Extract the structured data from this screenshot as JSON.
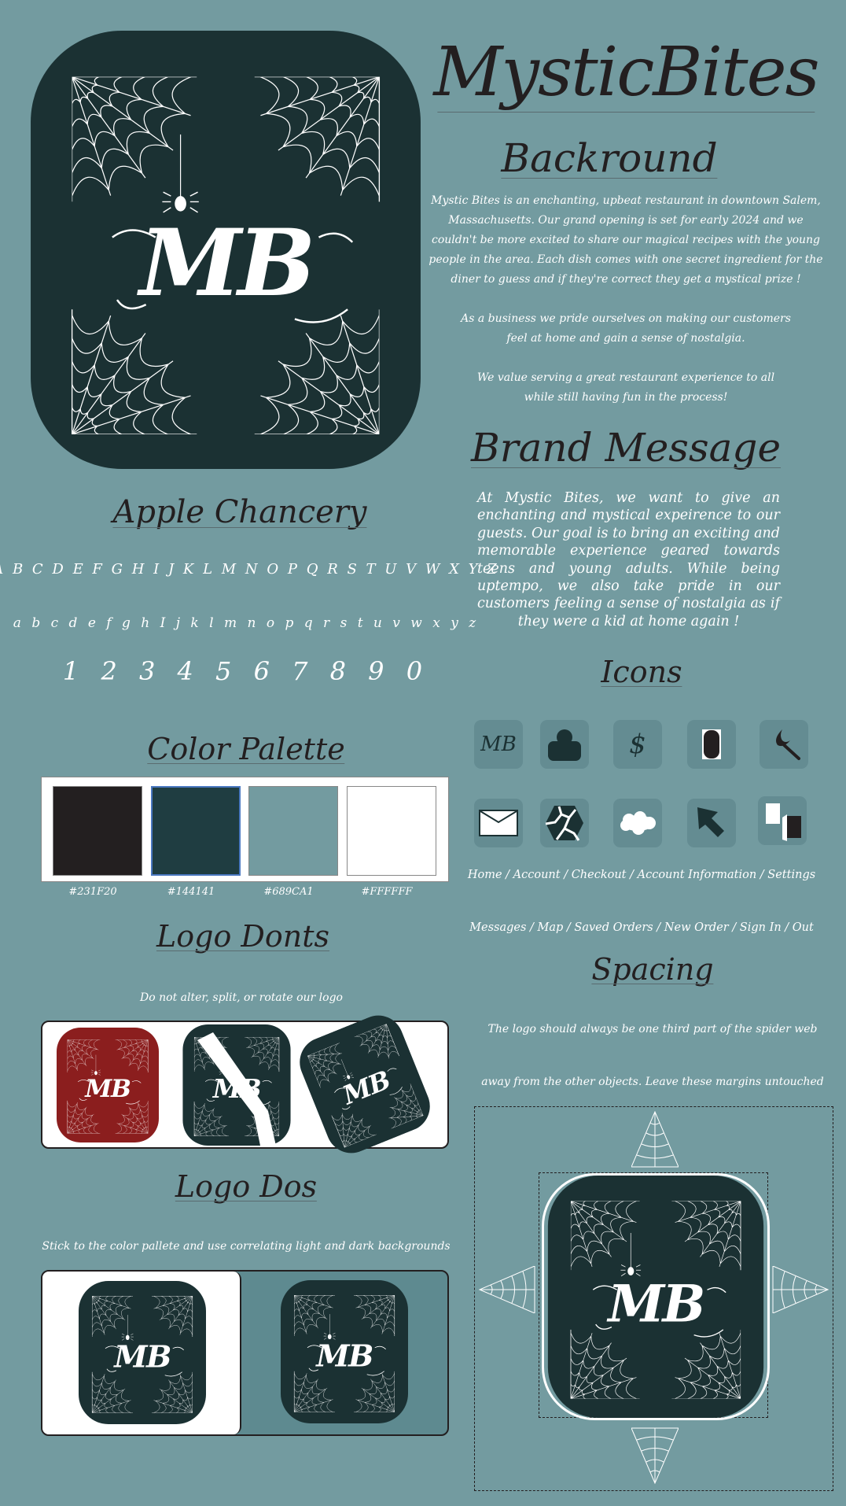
{
  "header": {
    "title": "MysticBites"
  },
  "background": {
    "heading": "Backround",
    "paragraphs": [
      "Mystic Bites is an enchanting, upbeat restaurant in downtown Salem, Massachusetts. Our grand opening is set for early 2024 and we couldn't be more excited to share our magical recipes with the young people in the area. Each dish comes with one secret ingredient for the diner to guess and if they're correct they get a mystical prize !",
      "As a business we pride ourselves on making our customers feel at home and gain a sense of nostalgia.",
      "We value serving a great restaurant experience to all while still having fun in the process!"
    ]
  },
  "brand_message": {
    "heading": "Brand Message",
    "text": "At Mystic Bites, we want to give an enchanting and mystical expeirence to our guests. Our goal is to bring  an exciting and memorable experience geared towards teens and young adults. While being uptempo, we also take pride in our customers feeling a sense of nostalgia as if they were a kid at home again !"
  },
  "typography": {
    "heading": "Apple Chancery",
    "uppercase": "A B C D E F G H I J K L M N O P Q R S T U V W X Y Z",
    "lowercase": "a b c d e f g h I j k l m n o p q r s t u v w x y z",
    "numbers": "1 2 3 4 5 6 7 8 9 0"
  },
  "palette": {
    "heading": "Color Palette",
    "colors": [
      {
        "hex": "#231F20",
        "label": "#231F20"
      },
      {
        "hex": "#1F3D41",
        "label": "#144141"
      },
      {
        "hex": "#739BA0",
        "label": "#689CA1"
      },
      {
        "hex": "#FFFFFF",
        "label": "#FFFFFF"
      }
    ]
  },
  "logo": {
    "monogram": "MB",
    "bg_color": "#1B3133",
    "dont_red": "#8B1E1E"
  },
  "logo_donts": {
    "heading": "Logo Donts",
    "text": "Do not alter, split, or rotate our logo"
  },
  "logo_dos": {
    "heading": "Logo Dos",
    "text": "Stick to the color pallete and use correlating light and dark backgrounds"
  },
  "icons": {
    "heading": "Icons",
    "items": [
      {
        "name": "home",
        "glyph": "MB"
      },
      {
        "name": "account",
        "glyph": ""
      },
      {
        "name": "checkout",
        "glyph": "$"
      },
      {
        "name": "account-information",
        "glyph": ""
      },
      {
        "name": "settings",
        "glyph": ""
      },
      {
        "name": "messages",
        "glyph": ""
      },
      {
        "name": "map",
        "glyph": ""
      },
      {
        "name": "saved-orders",
        "glyph": ""
      },
      {
        "name": "new-order",
        "glyph": ""
      },
      {
        "name": "sign-in-out",
        "glyph": ""
      }
    ],
    "legend_row1": "Home / Account / Checkout / Account Information / Settings",
    "legend_row2": "Messages / Map / Saved Orders / New Order / Sign In / Out"
  },
  "spacing": {
    "heading": "Spacing",
    "line1": "The logo should always be one third part of the spider web",
    "line2": "away from the other objects. Leave these margins untouched"
  }
}
